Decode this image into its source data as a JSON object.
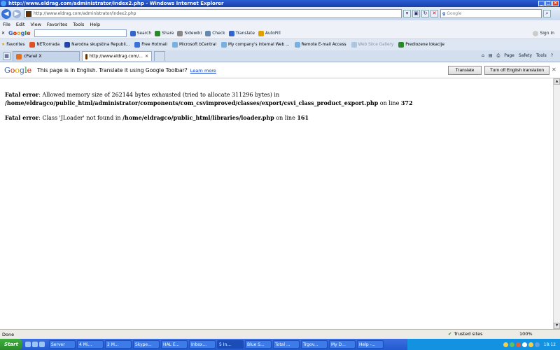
{
  "titlebar": {
    "title": "http://www.eldrag.com/administrator/index2.php - Windows Internet Explorer"
  },
  "addressbar": {
    "url": "http://www.eldrag.com/administrator/index2.php",
    "search_placeholder": "Google"
  },
  "menubar": {
    "items": [
      "File",
      "Edit",
      "View",
      "Favorites",
      "Tools",
      "Help"
    ]
  },
  "google_toolbar": {
    "logo": "Google",
    "items": [
      "Search",
      "Share",
      "Sidewiki",
      "Check",
      "Translate",
      "AutoFill"
    ],
    "signin": "Sign In"
  },
  "favorites_bar": {
    "label": "Favorites",
    "items": [
      "NETcorrada",
      "Narodna skupstina Republi...",
      "Free Hotmail",
      "Microsoft bCentral",
      "My company's internal Web ...",
      "Remote E-mail Access",
      "Web Slice Gallery",
      "Predlozene lokacije"
    ]
  },
  "tabs": [
    {
      "label": "cPanel X"
    },
    {
      "label": "http://www.eldrag.com/..."
    }
  ],
  "command_bar": {
    "page": "Page",
    "safety": "Safety",
    "tools": "Tools"
  },
  "translate_bar": {
    "logo": "Google",
    "message": "This page is in English.  Translate it using Google Toolbar?",
    "learn_more": "Learn more",
    "translate_btn": "Translate",
    "turn_off_btn": "Turn off English translation"
  },
  "content": {
    "errors": [
      {
        "label": "Fatal error",
        "text": ": Allowed memory size of 262144 bytes exhausted (tried to allocate 311296 bytes) in ",
        "path": "/home/eldragco/public_html/administrator/components/com_csvimproved/classes/export/csvi_class_product_export.php",
        "online": " on line ",
        "line": "372"
      },
      {
        "label": "Fatal error",
        "text": ": Class 'JLoader' not found in ",
        "path": "/home/eldragco/public_html/libraries/loader.php",
        "online": " on line ",
        "line": "161"
      }
    ]
  },
  "statusbar": {
    "status": "Done",
    "zone": "Trusted sites",
    "zoom": "100%"
  },
  "taskbar": {
    "start": "Start",
    "tasks": [
      "Server",
      "4 Mi...",
      "2 M...",
      "Skype...",
      "HAL E...",
      "Inbox...",
      "5 In...",
      "Blue S...",
      "Total ...",
      "Trgov...",
      "My D...",
      "Help -..."
    ],
    "clock": "18:12"
  }
}
